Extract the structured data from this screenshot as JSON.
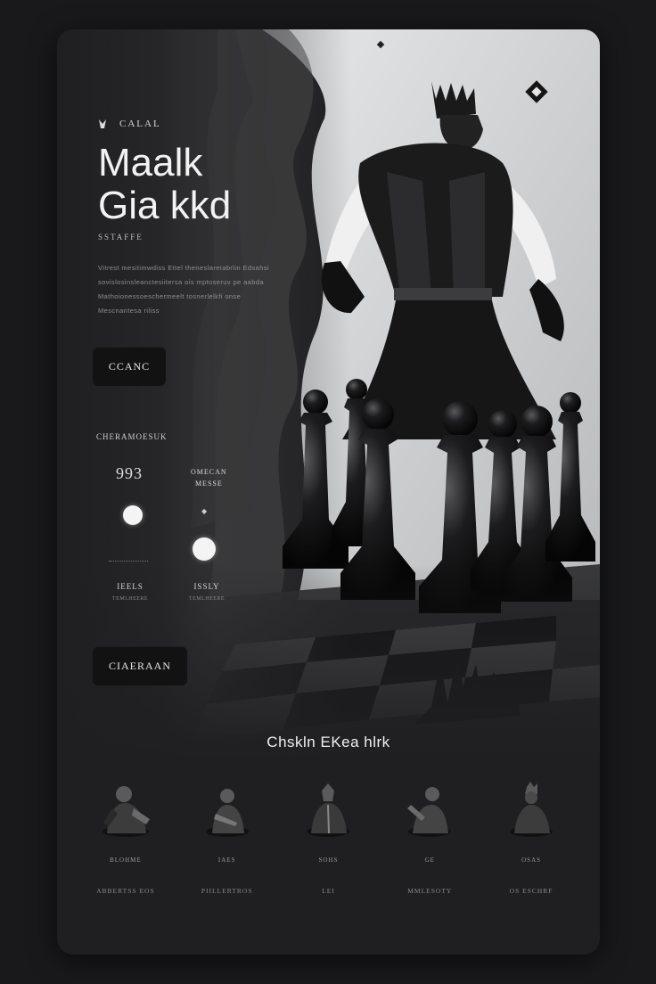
{
  "hero": {
    "eyebrow": "CALAL",
    "title_line1": "Maalk",
    "title_line2": "Gia kkd",
    "subtitle": "SSTAFFE",
    "paragraph": "Vitrest mesitimwdiss Ettel theneslaretabrlin Edsahsi sovislosinsleanctesiitersa ois mptoseruv pe aabda Mathoionessoeschermeelt tosnerlelkfi onse Mescnantesa riliss",
    "primary_button": "CCANC"
  },
  "settings": {
    "section_label": "CHERAMOESUK",
    "stat_value": "993",
    "stat_label_line1": "OMECAN",
    "stat_label_line2": "MESSE",
    "value_1": "IEELS",
    "value_1_caption": "TEMLHEERE",
    "value_2": "ISSLY",
    "value_2_caption": "TEMLHEERE",
    "secondary_button": "CIAERAAN"
  },
  "gallery": {
    "title": "Chskln EKea hlrk",
    "items": [
      {
        "caption": "BLOHME",
        "label": "ABBERTSS EOS"
      },
      {
        "caption": "IAES",
        "label": "PIILLERTROS"
      },
      {
        "caption": "SOHS",
        "label": "LEI"
      },
      {
        "caption": "GE",
        "label": "MMLESOTY"
      },
      {
        "caption": "OSAS",
        "label": "OS ESCHRF"
      }
    ]
  },
  "colors": {
    "card_bg": "#1f1f21",
    "page_bg": "#19191b",
    "hero_light": "#d9dadc",
    "accent_white": "#f4f4f4"
  },
  "icons": {
    "eyebrow": "crown-glyph-icon",
    "corner": "diamond-icon",
    "chevron": "chevron-down-icon"
  }
}
